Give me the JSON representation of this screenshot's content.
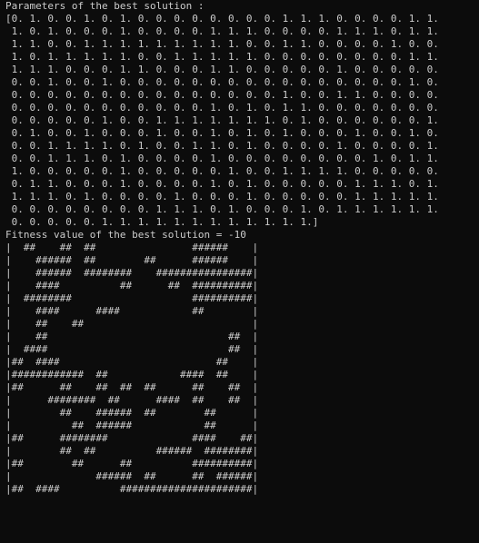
{
  "console": {
    "params_header": "Parameters of the best solution :",
    "params_lines": [
      "[0. 1. 0. 0. 1. 0. 1. 0. 0. 0. 0. 0. 0. 0. 0. 1. 1. 1. 0. 0. 0. 0. 1. 1.",
      " 1. 0. 1. 0. 0. 0. 1. 0. 0. 0. 0. 1. 1. 1. 0. 0. 0. 0. 1. 1. 1. 0. 1. 1.",
      " 1. 1. 0. 0. 1. 1. 1. 1. 1. 1. 1. 1. 1. 0. 0. 1. 1. 0. 0. 0. 0. 1. 0. 0.",
      " 1. 0. 1. 1. 1. 1. 1. 0. 0. 1. 1. 1. 1. 1. 0. 0. 0. 0. 0. 0. 0. 0. 1. 1.",
      " 1. 1. 1. 0. 0. 0. 1. 1. 0. 0. 0. 1. 1. 0. 0. 0. 0. 0. 1. 0. 0. 0. 0. 0.",
      " 0. 0. 1. 0. 0. 1. 0. 0. 0. 0. 0. 0. 0. 0. 0. 0. 0. 0. 0. 0. 0. 0. 1. 0.",
      " 0. 0. 0. 0. 0. 0. 0. 0. 0. 0. 0. 0. 0. 0. 0. 1. 0. 0. 1. 1. 0. 0. 0. 0.",
      " 0. 0. 0. 0. 0. 0. 0. 0. 0. 0. 0. 1. 0. 1. 0. 1. 1. 0. 0. 0. 0. 0. 0. 0.",
      " 0. 0. 0. 0. 0. 1. 0. 0. 1. 1. 1. 1. 1. 1. 1. 0. 1. 0. 0. 0. 0. 0. 0. 1.",
      " 0. 1. 0. 0. 1. 0. 0. 0. 1. 0. 0. 1. 0. 1. 0. 1. 0. 0. 0. 1. 0. 0. 1. 0.",
      " 0. 0. 1. 1. 1. 1. 0. 1. 0. 0. 1. 1. 0. 1. 0. 0. 0. 0. 1. 0. 0. 0. 0. 1.",
      " 0. 0. 1. 1. 1. 0. 1. 0. 0. 0. 0. 1. 0. 0. 0. 0. 0. 0. 0. 0. 1. 0. 1. 1.",
      " 1. 0. 0. 0. 0. 0. 1. 0. 0. 0. 0. 0. 1. 0. 0. 1. 1. 1. 1. 0. 0. 0. 0. 0.",
      " 0. 1. 1. 0. 0. 0. 1. 0. 0. 0. 0. 1. 0. 1. 0. 0. 0. 0. 0. 1. 1. 1. 0. 1.",
      " 1. 1. 1. 0. 1. 0. 0. 0. 0. 1. 0. 0. 0. 1. 0. 0. 0. 0. 0. 1. 1. 1. 1. 1.",
      " 0. 0. 0. 0. 0. 0. 0. 0. 1. 1. 1. 0. 1. 0. 0. 0. 1. 0. 1. 1. 1. 1. 1. 1.",
      " 0. 0. 0. 0. 0. 1. 1. 1. 1. 1. 1. 1. 1. 1. 1. 1. 1.]"
    ],
    "fitness_line": "Fitness value of the best solution = -10",
    "maze_lines": [
      "|  ##    ##  ##                ######    |",
      "|    ######  ##        ##      ######    |",
      "|    ######  ########    ################|",
      "|    ####          ##      ##  ##########|",
      "|  ########                    ##########|",
      "|    ####      ####            ##        |",
      "|    ##    ##                            |",
      "|    ##                              ##  |",
      "|  ####                              ##  |",
      "|##  ####                          ##    |",
      "|############  ##            ####  ##    |",
      "|##      ##    ##  ##  ##      ##    ##  |",
      "|      ########  ##      ####  ##    ##  |",
      "|        ##    ######  ##        ##      |",
      "|          ##  ######            ##      |",
      "|##      ########              ####    ##|",
      "|        ##  ##          ######  ########|",
      "|##        ##      ##          ##########|",
      "|              ######  ##      ##  ######|",
      "|##  ####          ######################|"
    ]
  }
}
